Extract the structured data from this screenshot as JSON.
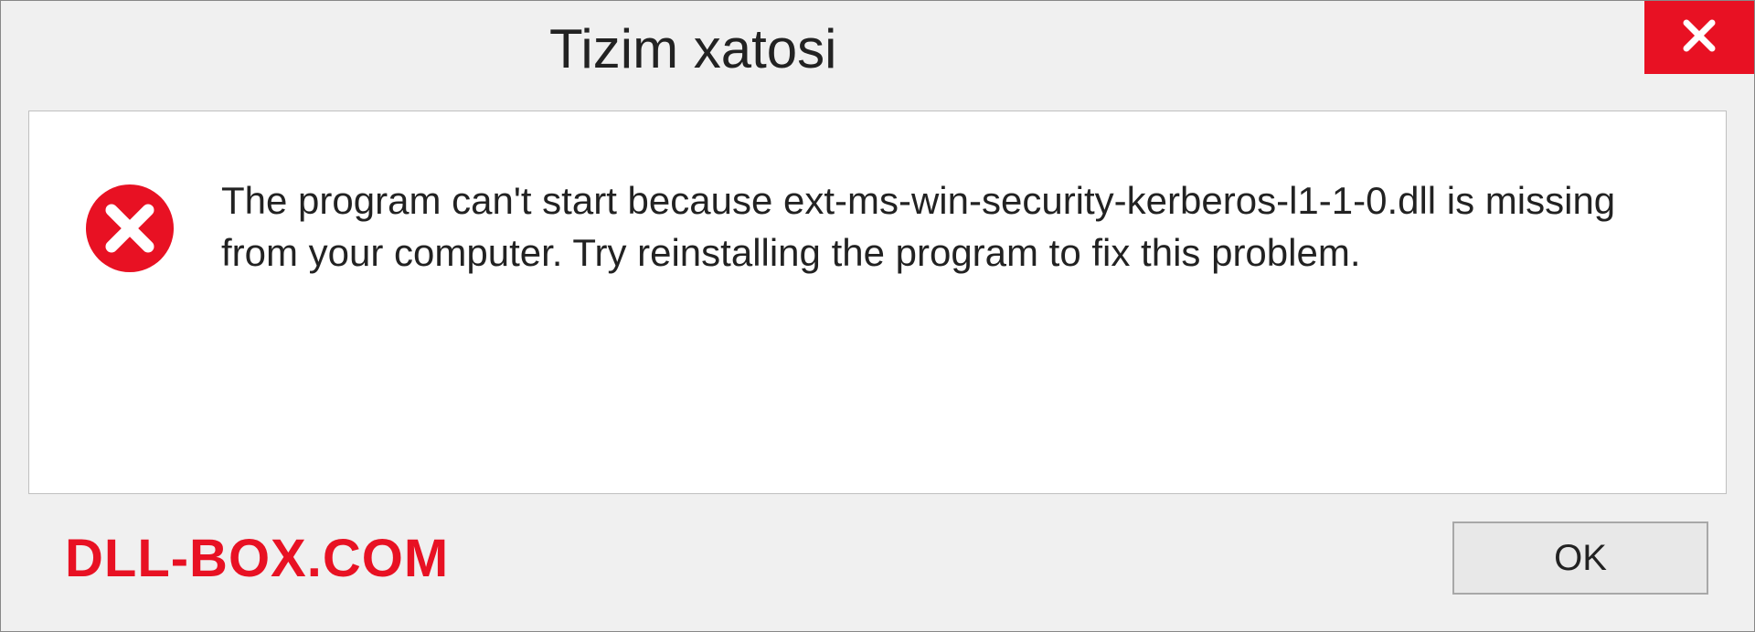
{
  "dialog": {
    "title": "Tizim xatosi",
    "message": "The program can't start because ext-ms-win-security-kerberos-l1-1-0.dll is missing from your computer. Try reinstalling the program to fix this problem.",
    "ok_label": "OK",
    "watermark": "DLL-BOX.COM"
  }
}
